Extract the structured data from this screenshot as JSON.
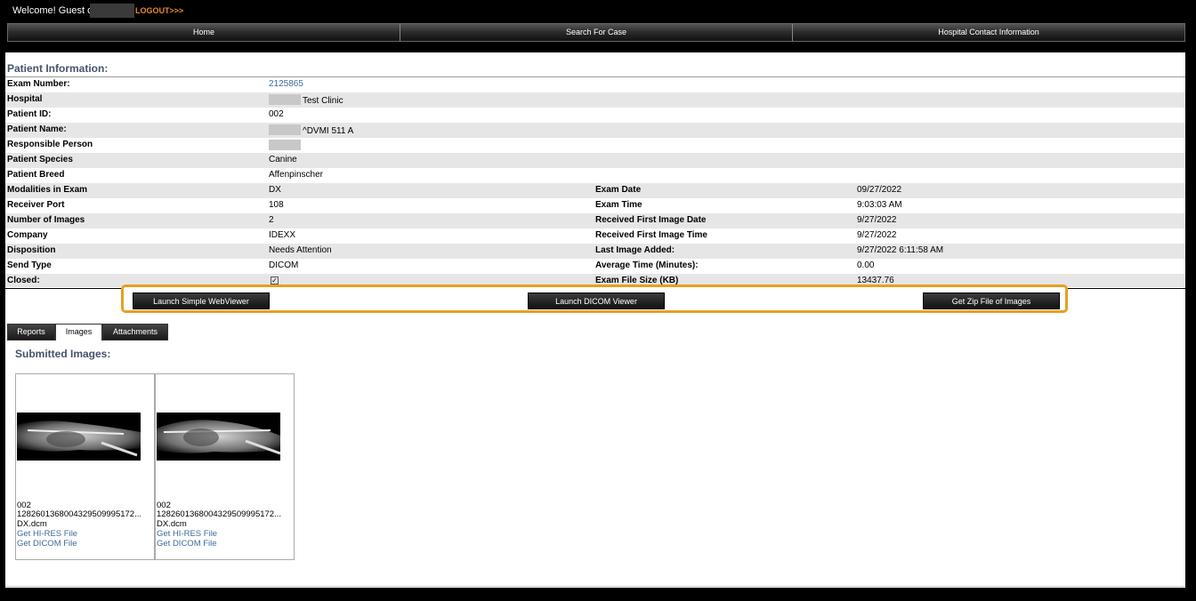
{
  "topbar": {
    "welcome": "Welcome! Guest of",
    "logout": "LOGOUT>>>"
  },
  "nav": {
    "home": "Home",
    "search": "Search For Case",
    "contact": "Hospital Contact Information"
  },
  "patient": {
    "title": "Patient Information:",
    "rows": [
      {
        "label": "Exam Number:",
        "value": "2125865"
      },
      {
        "label": "Hospital",
        "value": "Test Clinic"
      },
      {
        "label": "Patient ID:",
        "value": "002"
      },
      {
        "label": "Patient Name:",
        "value": "^DVMI 511 A"
      },
      {
        "label": "Responsible Person",
        "value": ""
      },
      {
        "label": "Patient Species",
        "value": "Canine"
      },
      {
        "label": "Patient Breed",
        "value": "Affenpinscher"
      },
      {
        "label": "Modalities in Exam",
        "value": "DX",
        "label2": "Exam Date",
        "value2": "09/27/2022"
      },
      {
        "label": "Receiver Port",
        "value": "108",
        "label2": "Exam Time",
        "value2": "9:03:03 AM"
      },
      {
        "label": "Number of Images",
        "value": "2",
        "label2": "Received First Image Date",
        "value2": "9/27/2022"
      },
      {
        "label": "Company",
        "value": "IDEXX",
        "label2": "Received First Image Time",
        "value2": "9/27/2022"
      },
      {
        "label": "Disposition",
        "value": "Needs Attention",
        "label2": "Last Image Added:",
        "value2": "9/27/2022 6:11:58 AM"
      },
      {
        "label": "Send Type",
        "value": "DICOM",
        "label2": "Average Time (Minutes):",
        "value2": "0.00"
      },
      {
        "label": "Closed:",
        "value": "",
        "label2": "Exam File Size (KB)",
        "value2": "13437.76"
      }
    ]
  },
  "actions": {
    "simple_viewer": "Launch Simple WebViewer",
    "dicom_viewer": "Launch DICOM Viewer",
    "zip": "Get Zip File of Images"
  },
  "tabs": {
    "reports": "Reports",
    "images": "Images",
    "attachments": "Attachments"
  },
  "images": {
    "title": "Submitted Images:",
    "items": [
      {
        "id": "002",
        "uid": "1282601368004329509995172...",
        "file": "DX.dcm",
        "hires": "Get HI-RES File",
        "dicom": "Get DICOM File"
      },
      {
        "id": "002",
        "uid": "1282601368004329509995172...",
        "file": "DX.dcm",
        "hires": "Get HI-RES File",
        "dicom": "Get DICOM File"
      }
    ]
  },
  "colors": {
    "accent": "#e6a020",
    "link": "#3d6a9a",
    "logout": "#e08a2c"
  }
}
